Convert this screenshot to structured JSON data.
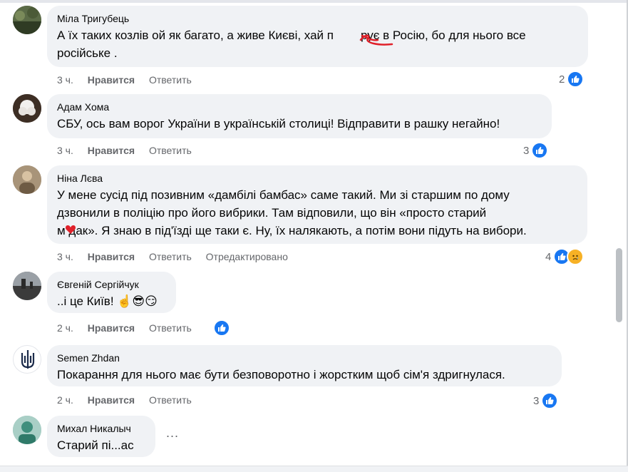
{
  "comments": [
    {
      "author": "Міла Тригубець",
      "lines": [
        "А їх таких козлів ой як багато, а живе Києві, хай п",
        "рує в Росію, бо для нього все",
        "російське ."
      ],
      "time": "3 ч.",
      "like_label": "Нравится",
      "reply_label": "Ответить",
      "reaction_count": "2",
      "avatar": "forest-photo"
    },
    {
      "author": "Адам Хома",
      "lines": [
        "СБУ, ось вам ворог України в українській столиці! Відправити в рашку негайно!"
      ],
      "time": "3 ч.",
      "like_label": "Нравится",
      "reply_label": "Ответить",
      "reaction_count": "3",
      "avatar": "flower-photo"
    },
    {
      "author": "Ніна Лєва",
      "lines": [
        "У мене сусід під позивним «дамбілі бамбас» саме такий. Ми зі старшим по дому",
        "дзвонили в поліцію про його вибрики. Там відповили, що він «просто старий",
        "м дак». Я знаю в під'їзді ще таки є. Ну, їх налякають, а потім вони підуть на вибори."
      ],
      "time": "3 ч.",
      "like_label": "Нравится",
      "reply_label": "Ответить",
      "edited_label": "Отредактировано",
      "reaction_count": "4",
      "avatar": "portrait-photo"
    },
    {
      "author": "Євгеній Сергійчук",
      "lines": [
        "..і це Київ! ☝️😎😏"
      ],
      "time": "2 ч.",
      "like_label": "Нравится",
      "reply_label": "Ответить",
      "avatar": "landscape-photo"
    },
    {
      "author": "Semen Zhdan",
      "lines": [
        "Покарання для нього має бути безповоротно і жорстким щоб сім'я здригнулася."
      ],
      "time": "2 ч.",
      "like_label": "Нравится",
      "reply_label": "Ответить",
      "reaction_count": "3",
      "avatar": "trident-emblem"
    },
    {
      "author": "Михал Никалыч",
      "lines": [
        "Старий пі...ас"
      ],
      "more_label": "...",
      "avatar": "medic-photo"
    }
  ],
  "colors": {
    "bubble": "#f0f2f5",
    "like_blue": "#1877f2",
    "meta_gray": "#65676b",
    "scribble_red": "#e0212a"
  }
}
